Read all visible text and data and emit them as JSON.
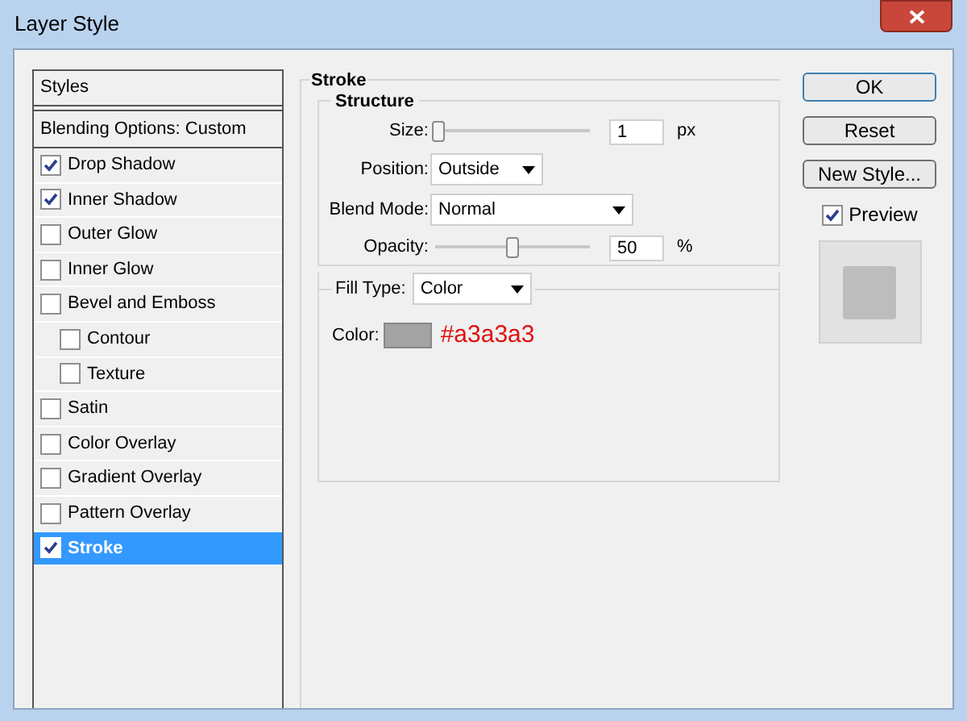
{
  "window": {
    "title": "Layer Style"
  },
  "styles_list": {
    "header": "Styles",
    "blending": "Blending Options: Custom",
    "items": [
      {
        "label": "Drop Shadow",
        "checked": true,
        "selected": false,
        "nested": false
      },
      {
        "label": "Inner Shadow",
        "checked": true,
        "selected": false,
        "nested": false
      },
      {
        "label": "Outer Glow",
        "checked": false,
        "selected": false,
        "nested": false
      },
      {
        "label": "Inner Glow",
        "checked": false,
        "selected": false,
        "nested": false
      },
      {
        "label": "Bevel and Emboss",
        "checked": false,
        "selected": false,
        "nested": false
      },
      {
        "label": "Contour",
        "checked": false,
        "selected": false,
        "nested": true
      },
      {
        "label": "Texture",
        "checked": false,
        "selected": false,
        "nested": true
      },
      {
        "label": "Satin",
        "checked": false,
        "selected": false,
        "nested": false
      },
      {
        "label": "Color Overlay",
        "checked": false,
        "selected": false,
        "nested": false
      },
      {
        "label": "Gradient Overlay",
        "checked": false,
        "selected": false,
        "nested": false
      },
      {
        "label": "Pattern Overlay",
        "checked": false,
        "selected": false,
        "nested": false
      },
      {
        "label": "Stroke",
        "checked": true,
        "selected": true,
        "nested": false
      }
    ]
  },
  "stroke": {
    "title": "Stroke",
    "structure": {
      "title": "Structure",
      "size": {
        "label": "Size:",
        "level": 0.02,
        "value": "1",
        "unit": "px"
      },
      "position": {
        "label": "Position:",
        "value": "Outside"
      },
      "blend_mode": {
        "label": "Blend Mode:",
        "value": "Normal"
      },
      "opacity": {
        "label": "Opacity:",
        "level": 0.5,
        "value": "50",
        "unit": "%"
      }
    },
    "fill": {
      "label": "Fill Type:",
      "value": "Color",
      "color_label": "Color:",
      "color": "#a3a3a3",
      "color_text": "#a3a3a3"
    }
  },
  "buttons": [
    "OK",
    "Reset",
    "New Style..."
  ],
  "preview": {
    "label": "Preview",
    "checked": true
  }
}
